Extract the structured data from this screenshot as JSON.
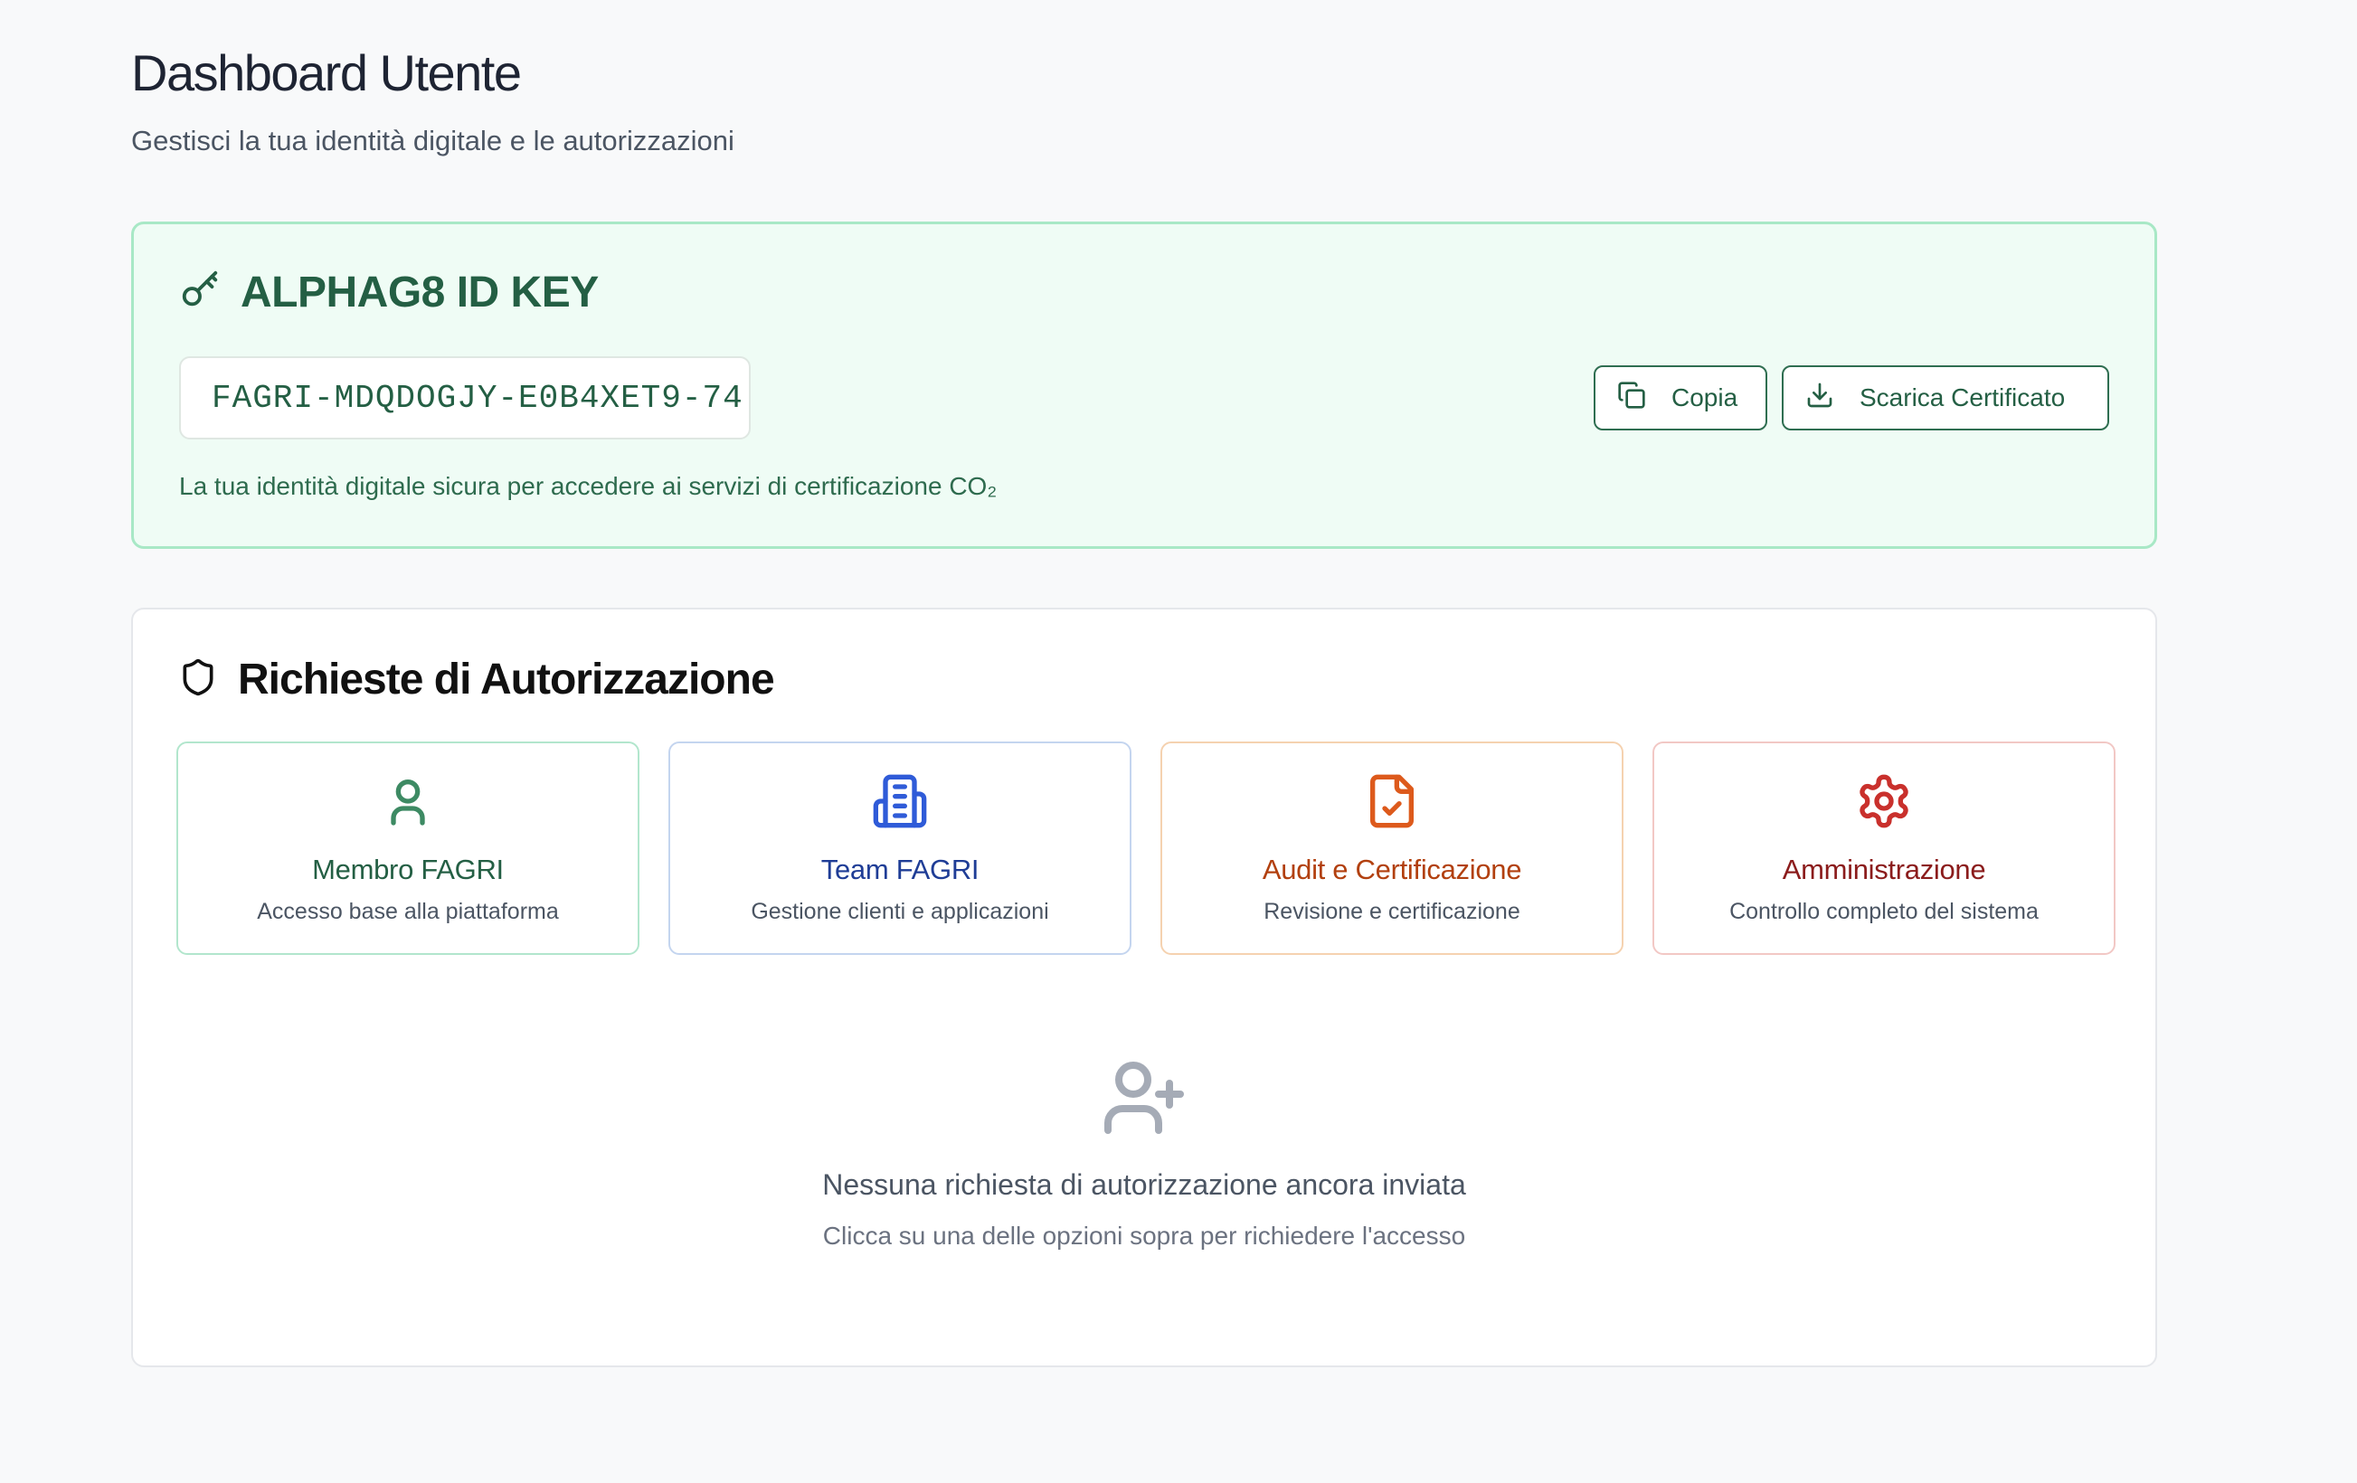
{
  "header": {
    "title": "Dashboard Utente",
    "subtitle": "Gestisci la tua identità digitale e le autorizzazioni"
  },
  "id_card": {
    "title": "ALPHAG8 ID KEY",
    "key_value": "FAGRI-MDQDOGJY-E0B4XET9-74",
    "description": "La tua identità digitale sicura per accedere ai servizi di certificazione CO₂",
    "copy_label": "Copia",
    "download_label": "Scarica Certificato",
    "icons": {
      "title": "key-icon",
      "copy": "copy-icon",
      "download": "download-icon"
    },
    "colors": {
      "accent": "#245f44",
      "background": "#effcf5",
      "border": "#a8e8c6"
    }
  },
  "authorization": {
    "title": "Richieste di Autorizzazione",
    "icon": "shield-icon",
    "options": [
      {
        "label": "Membro FAGRI",
        "description": "Accesso base alla piattaforma",
        "icon": "user-icon",
        "color": "#3d8a63"
      },
      {
        "label": "Team FAGRI",
        "description": "Gestione clienti e applicazioni",
        "icon": "building-icon",
        "color": "#2f5bd8"
      },
      {
        "label": "Audit e Certificazione",
        "description": "Revisione e certificazione",
        "icon": "file-check-icon",
        "color": "#dd5a1c"
      },
      {
        "label": "Amministrazione",
        "description": "Controllo completo del sistema",
        "icon": "gear-icon",
        "color": "#c9302c"
      }
    ],
    "empty_state": {
      "icon": "user-plus-icon",
      "title": "Nessuna richiesta di autorizzazione ancora inviata",
      "hint": "Clicca su una delle opzioni sopra per richiedere l'accesso"
    }
  }
}
